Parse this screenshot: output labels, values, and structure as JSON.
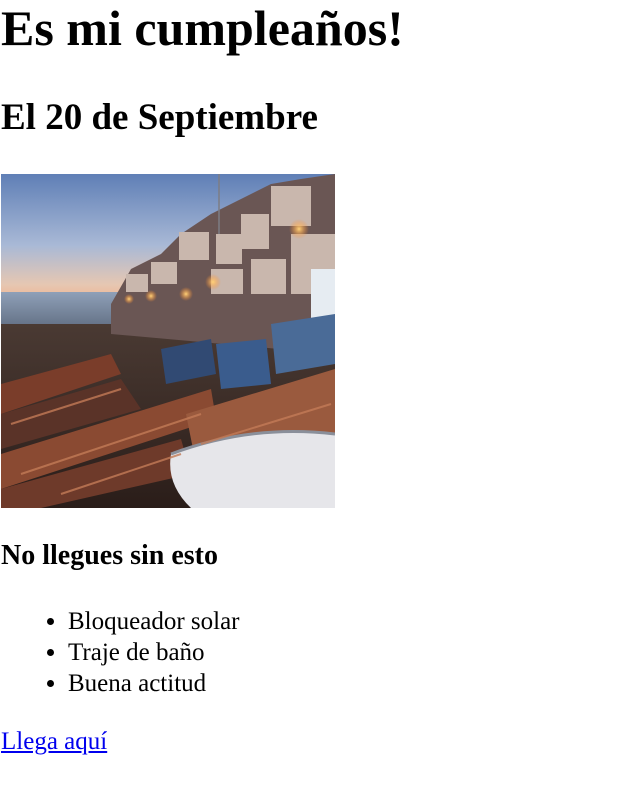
{
  "header": {
    "title": "Es mi cumpleaños!",
    "date": "El 20 de Septiembre"
  },
  "photo": {
    "subject": "coastal town beach with wooden fishing boats at dusk"
  },
  "checklist": {
    "heading": "No llegues sin esto",
    "items": [
      "Bloqueador solar",
      "Traje de baño",
      "Buena actitud"
    ]
  },
  "footer": {
    "link_label": "Llega aquí"
  },
  "colors": {
    "link": "#0000ee",
    "text": "#000000",
    "background": "#ffffff"
  }
}
